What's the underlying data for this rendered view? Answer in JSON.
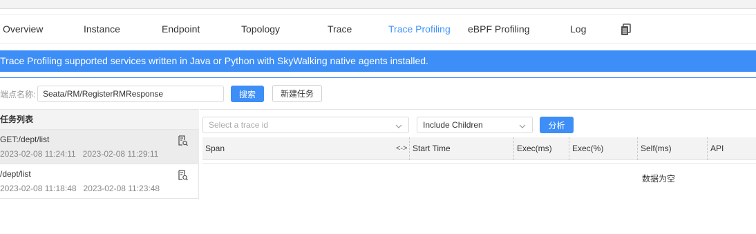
{
  "tabs": [
    {
      "label": "Overview"
    },
    {
      "label": "Instance"
    },
    {
      "label": "Endpoint"
    },
    {
      "label": "Topology"
    },
    {
      "label": "Trace"
    },
    {
      "label": "Trace Profiling"
    },
    {
      "label": "eBPF Profiling"
    },
    {
      "label": "Log"
    }
  ],
  "active_tab": "Trace Profiling",
  "banner": {
    "text": "Trace Profiling supported services written in Java or Python with SkyWalking native agents installed."
  },
  "endpoint": {
    "label": "端点名称:",
    "value": "Seata/RM/RegisterRMResponse"
  },
  "buttons": {
    "search": "搜索",
    "new_task": "新建任务",
    "analyze": "分析"
  },
  "task_list": {
    "title": "任务列表",
    "tasks": [
      {
        "name": "GET:/dept/list",
        "start": "2023-02-08 11:24:11",
        "end": "2023-02-08 11:29:11"
      },
      {
        "name": "/dept/list",
        "start": "2023-02-08 11:18:48",
        "end": "2023-02-08 11:23:48"
      }
    ]
  },
  "trace_select": {
    "placeholder": "Select a trace id"
  },
  "children_select": {
    "value": "Include Children"
  },
  "table": {
    "columns": [
      "Span",
      "Start Time",
      "Exec(ms)",
      "Exec(%)",
      "Self(ms)",
      "API"
    ],
    "resize_glyph": "<->",
    "empty_text": "数据为空"
  },
  "colors": {
    "accent": "#3d8ef7",
    "header_bg": "#f3f3f3",
    "selected_row": "#ececec"
  },
  "icons": {
    "tab_extra": "copy-icon",
    "task": "document-search-icon"
  }
}
